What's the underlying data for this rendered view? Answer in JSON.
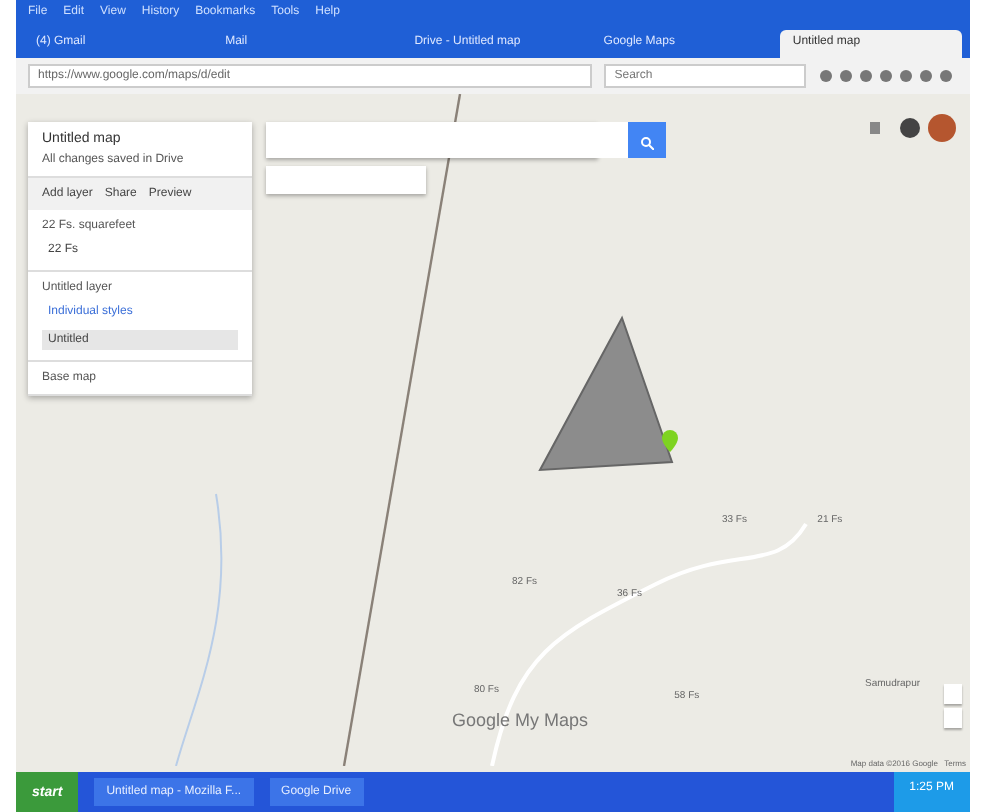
{
  "browser": {
    "menu": [
      "File",
      "Edit",
      "View",
      "History",
      "Bookmarks",
      "Tools",
      "Help"
    ],
    "tabs": [
      {
        "label": "(4) Gmail",
        "selected": false
      },
      {
        "label": "Mail",
        "selected": false
      },
      {
        "label": "Drive - Untitled map",
        "selected": false
      },
      {
        "label": "Google Maps",
        "selected": false
      },
      {
        "label": "Untitled map",
        "selected": true
      }
    ],
    "url": "https://www.google.com/maps/d/edit",
    "search_placeholder": "Search"
  },
  "panel": {
    "title": "Untitled map",
    "subtitle": "All changes saved in Drive",
    "actions": [
      "Add layer",
      "Share",
      "Preview"
    ],
    "layers": [
      {
        "title": "22 Fs. squarefeet",
        "items": [
          {
            "label": "22 Fs",
            "kind": "pin",
            "selected": false
          }
        ]
      },
      {
        "title": "Untitled layer",
        "items": [
          {
            "label": "Individual styles",
            "kind": "link",
            "selected": false
          },
          {
            "label": "Untitled",
            "kind": "shape",
            "selected": true
          }
        ]
      }
    ],
    "base_map": "Base map"
  },
  "map": {
    "labels": [
      "33 Fs",
      "21 Fs",
      "82 Fs",
      "36 Fs",
      "80 Fs",
      "58 Fs",
      "Samudrapur"
    ],
    "logo": "Google My Maps",
    "attribution": "Map data ©2016 Google",
    "terms": "Terms"
  },
  "taskbar": {
    "start": "start",
    "tasks": [
      "Untitled map - Mozilla F...",
      "Google Drive"
    ],
    "clock": "1:25 PM"
  }
}
